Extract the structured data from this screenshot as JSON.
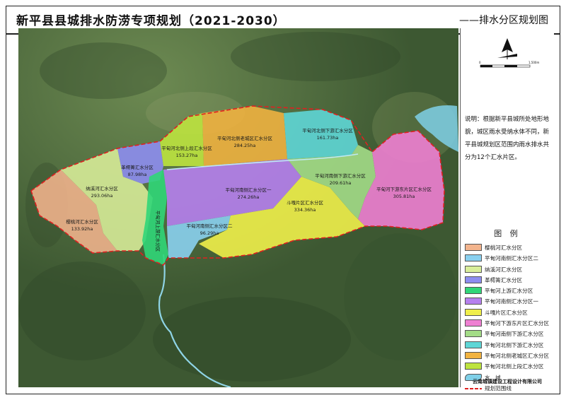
{
  "header": {
    "title": "新平县县城排水防涝专项规划（2021-2030）",
    "subtitle": "——排水分区规划图"
  },
  "note": {
    "text": "说明：根据新平县城所处地形地貌，城区雨水受纳水体不同，新平县城规划区范围内雨水排水共分为12个汇水片区。"
  },
  "compass": {
    "scale_zero": "0",
    "scale_end": "1,500m"
  },
  "zones": [
    {
      "name": "平甸河北侧下游汇水分区",
      "area": "161.73ha",
      "color": "#5ed6d6"
    },
    {
      "name": "平甸河北侧老城区汇水分区",
      "area": "284.25ha",
      "color": "#f2b340"
    },
    {
      "name": "平甸河北侧上段汇水分区",
      "area": "153.27ha",
      "color": "#bde33f"
    },
    {
      "name": "革樗箐汇水分区",
      "area": "87.98ha",
      "color": "#8d8df0"
    },
    {
      "name": "纳溪河汇水分区",
      "area": "293.06ha",
      "color": "#d9ee9a"
    },
    {
      "name": "樱桃河汇水分区",
      "area": "133.92ha",
      "color": "#f3b48d"
    },
    {
      "name": "平甸河上游汇水分区",
      "area": "",
      "color": "#30d678"
    },
    {
      "name": "平甸河南侧汇水分区一",
      "area": "274.26ha",
      "color": "#b680ee"
    },
    {
      "name": "平甸河南侧汇水分区二",
      "area": "96.29ha",
      "color": "#89d0ef"
    },
    {
      "name": "斗嘎片区汇水分区",
      "area": "334.36ha",
      "color": "#f0ef4a"
    },
    {
      "name": "平甸河南侧下游汇水分区",
      "area": "209.61ha",
      "color": "#a3dc87"
    },
    {
      "name": "平甸河下游东片区汇水分区",
      "area": "305.81ha",
      "color": "#ee7fd2"
    }
  ],
  "legend": {
    "title": "图 例",
    "items": [
      {
        "label": "樱桃河汇水分区",
        "color": "#f3b48d"
      },
      {
        "label": "平甸河南侧汇水分区二",
        "color": "#89d0ef"
      },
      {
        "label": "纳溪河汇水分区",
        "color": "#d9ee9a"
      },
      {
        "label": "革樗箐汇水分区",
        "color": "#8d8df0"
      },
      {
        "label": "平甸河上游汇水分区",
        "color": "#30d678"
      },
      {
        "label": "平甸河南侧汇水分区一",
        "color": "#b680ee"
      },
      {
        "label": "斗嘎片区汇水分区",
        "color": "#f0ef4a"
      },
      {
        "label": "平甸河下游东片区汇水分区",
        "color": "#ee7fd2"
      },
      {
        "label": "平甸河南侧下游汇水分区",
        "color": "#a3dc87"
      },
      {
        "label": "平甸河北侧下游汇水分区",
        "color": "#5ed6d6"
      },
      {
        "label": "平甸河北侧老城区汇水分区",
        "color": "#f2b340"
      },
      {
        "label": "平甸河北侧上段汇水分区",
        "color": "#bde33f"
      },
      {
        "label": "水　域",
        "color": "#7fd0e8",
        "icon": "water-icon"
      },
      {
        "label": "规划范围线",
        "color": "#e02020",
        "icon": "boundary-line-icon"
      }
    ]
  },
  "company": "云南城镇建设工程设计有限公司",
  "colors": {
    "satellite_base": "#4f6b3f",
    "river": "#8fd4e6",
    "boundary": "#e02020"
  }
}
